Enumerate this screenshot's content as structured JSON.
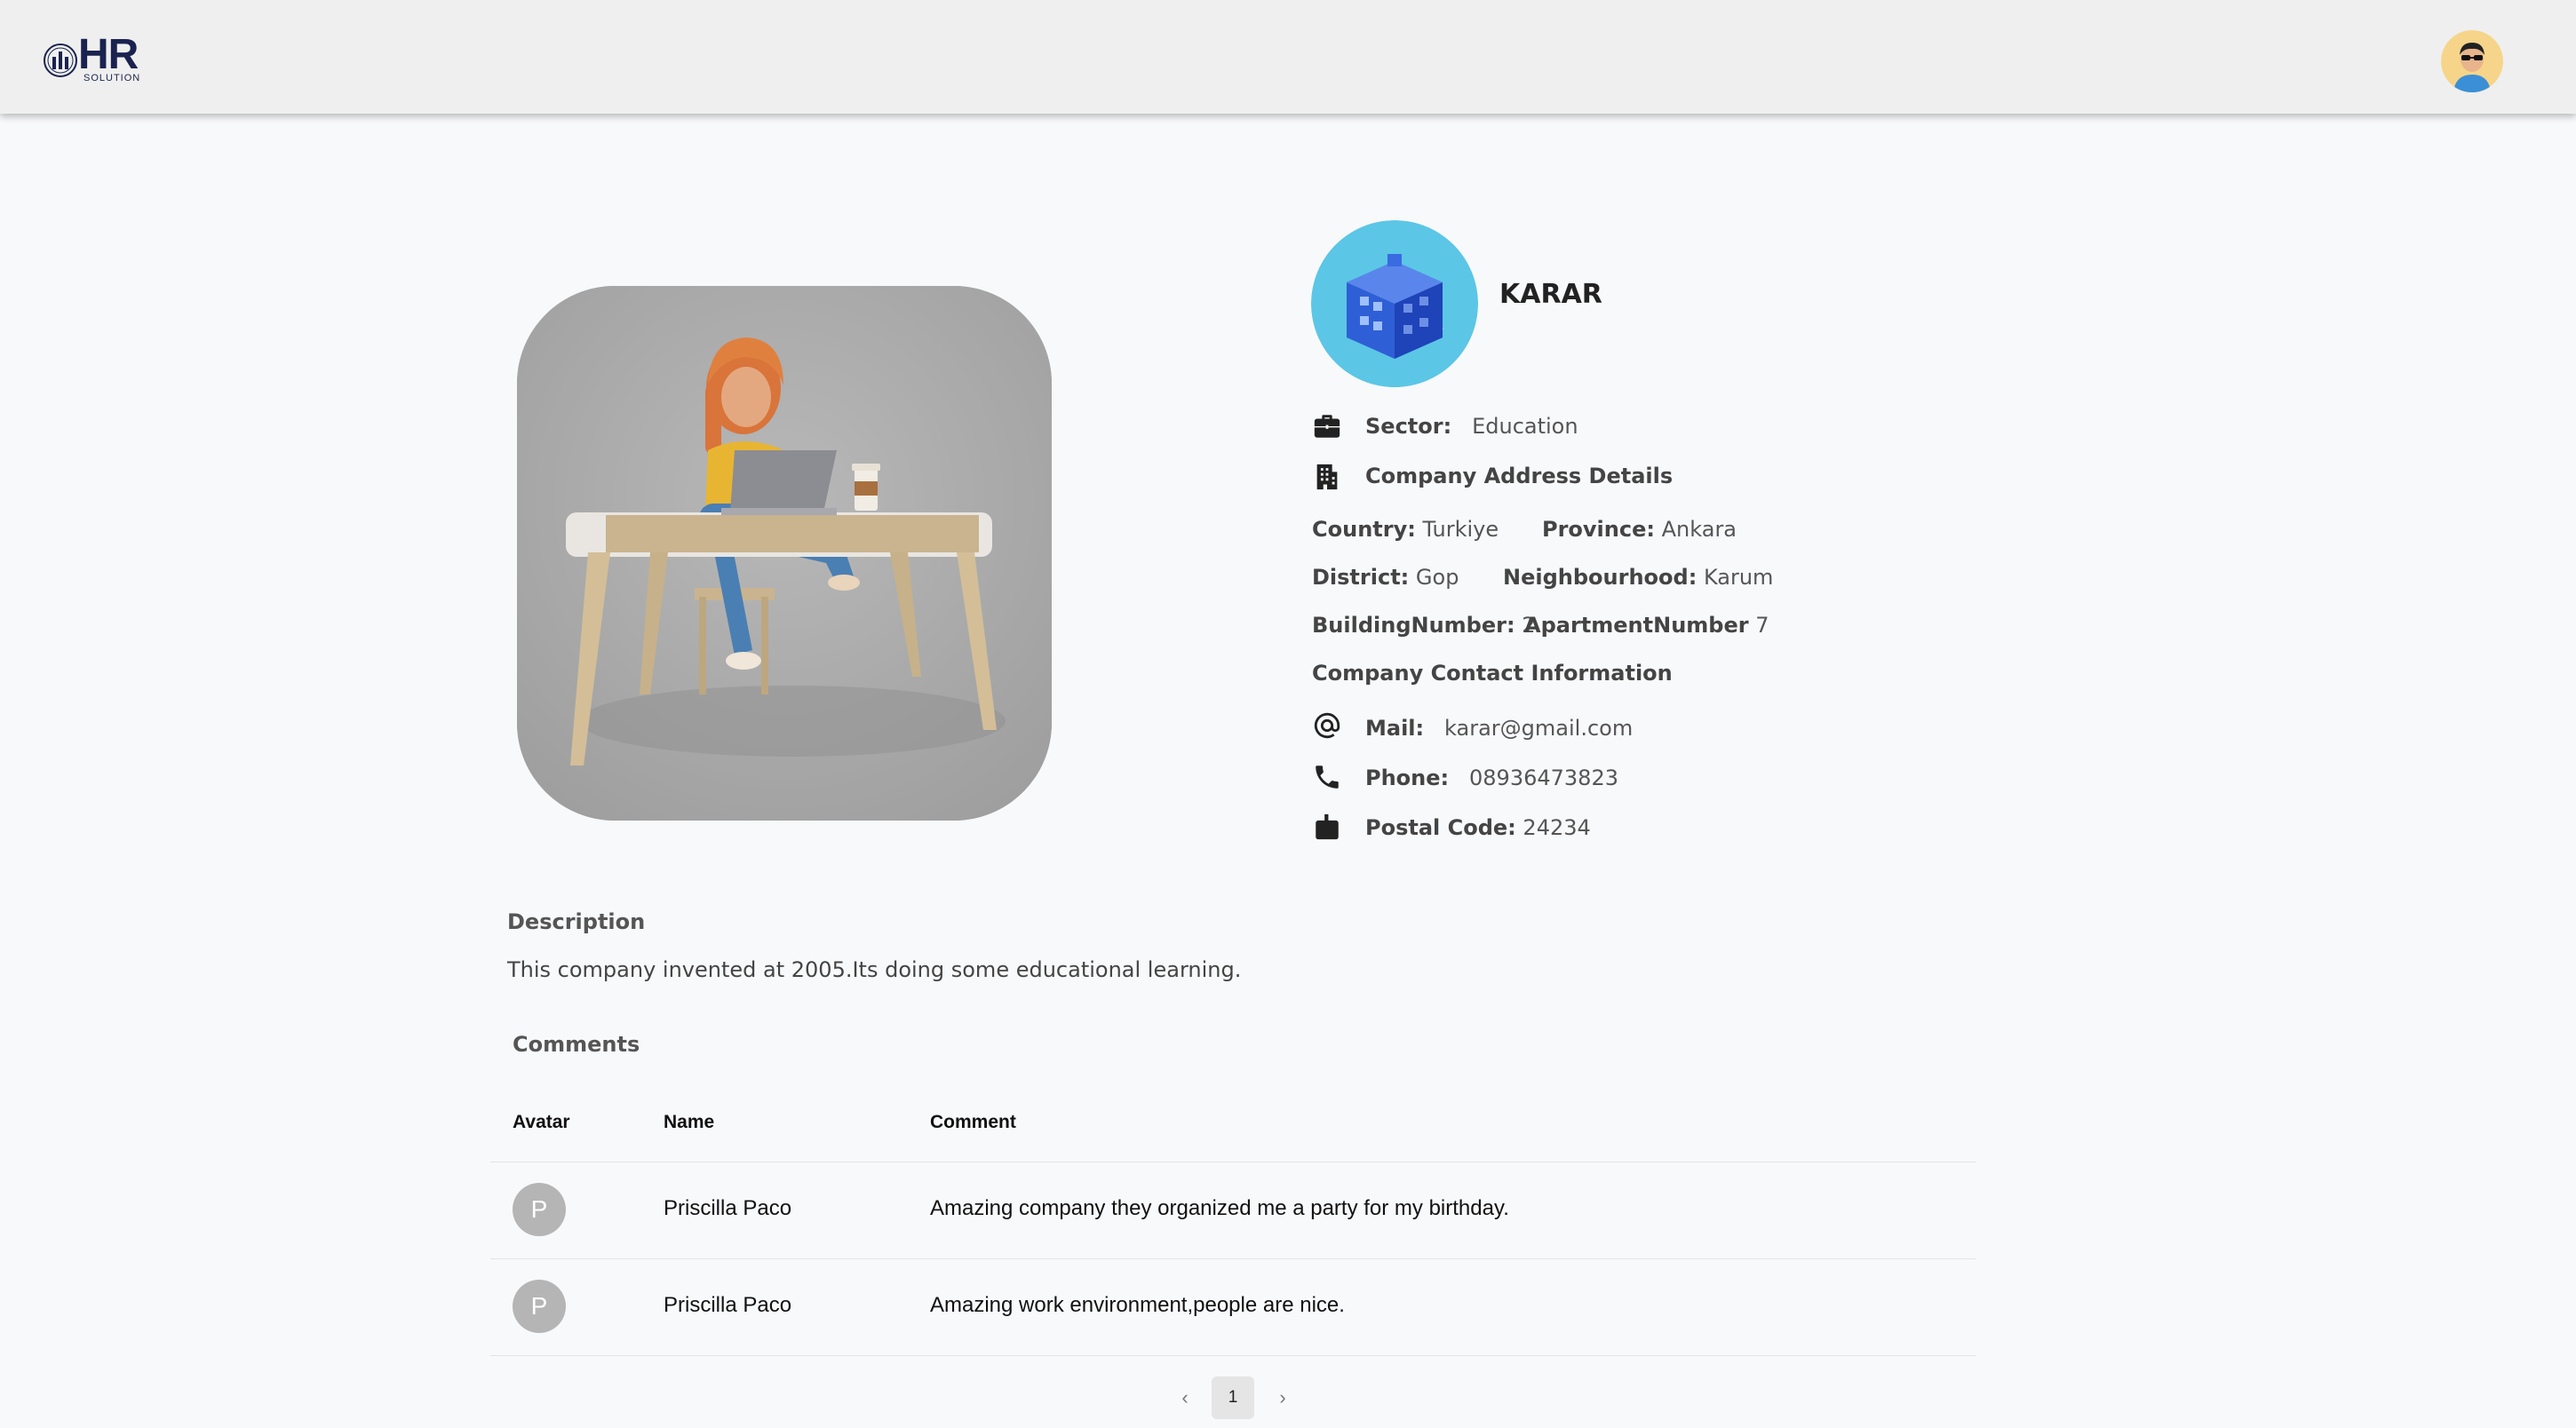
{
  "header": {
    "logo_text": "HR",
    "logo_subtext": "SOLUTION"
  },
  "company": {
    "name": "KARAR",
    "sector_label": "Sector:",
    "sector": "Education",
    "address_title": "Company Address Details",
    "country_label": "Country:",
    "country": "Turkiye",
    "province_label": "Province:",
    "province": "Ankara",
    "district_label": "District:",
    "district": "Gop",
    "neighbourhood_label": "Neighbourhood:",
    "neighbourhood": "Karum",
    "building_label": "BuildingNumber:",
    "building": "2",
    "apartment_label": "ApartmentNumber",
    "apartment": "7",
    "contact_title": "Company Contact Information",
    "mail_label": "Mail:",
    "mail": "karar@gmail.com",
    "phone_label": "Phone:",
    "phone": "08936473823",
    "postal_label": "Postal Code:",
    "postal": "24234"
  },
  "description": {
    "title": "Description",
    "text": "This company invented at 2005.Its doing some educational learning."
  },
  "comments": {
    "title": "Comments",
    "headers": {
      "avatar": "Avatar",
      "name": "Name",
      "comment": "Comment"
    },
    "rows": [
      {
        "initial": "P",
        "name": "Priscilla Paco",
        "comment": "Amazing company they organized me a party for my birthday."
      },
      {
        "initial": "P",
        "name": "Priscilla Paco",
        "comment": "Amazing work environment,people are nice."
      }
    ]
  },
  "pagination": {
    "prev": "‹",
    "current": "1",
    "next": "›"
  },
  "colors": {
    "header_bg": "#efefef",
    "page_bg": "#f8f9fb",
    "avatar_gray": "#b5b5b5",
    "company_logo_bg": "#5cc6e6"
  },
  "icons": [
    "briefcase-icon",
    "building-icon",
    "at-sign-icon",
    "phone-icon",
    "mailbox-icon",
    "chevron-left-icon",
    "chevron-right-icon"
  ]
}
